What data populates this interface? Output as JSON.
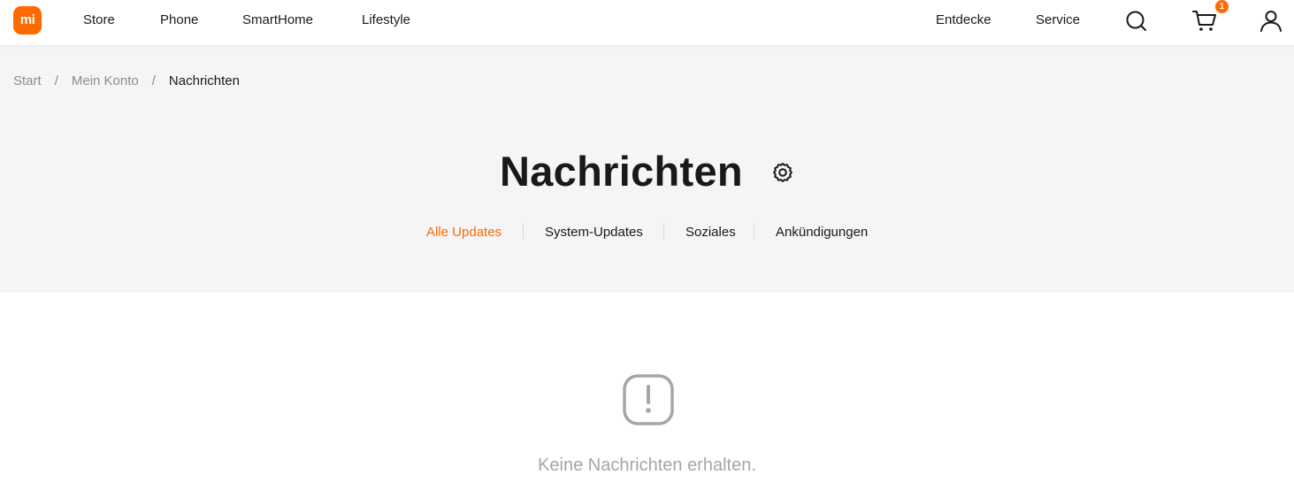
{
  "brand": {
    "logo_text": "mi",
    "accent_color": "#ff6900"
  },
  "nav": {
    "left_links": [
      "Store",
      "Phone",
      "SmartHome",
      "Lifestyle"
    ],
    "right_links": [
      "Entdecke",
      "Service"
    ],
    "icons": {
      "search": "search-icon",
      "cart": "cart-icon",
      "account": "user-icon"
    },
    "cart_count": "1"
  },
  "breadcrumb": {
    "items": [
      "Start",
      "Mein Konto",
      "Nachrichten"
    ],
    "separator": "/"
  },
  "page": {
    "title": "Nachrichten",
    "settings_icon": "gear-icon"
  },
  "tabs": [
    {
      "label": "Alle Updates",
      "active": true
    },
    {
      "label": "System-Updates",
      "active": false
    },
    {
      "label": "Soziales",
      "active": false
    },
    {
      "label": "Ankündigungen",
      "active": false
    }
  ],
  "empty_state": {
    "icon": "exclamation-icon",
    "message": "Keine Nachrichten erhalten."
  }
}
